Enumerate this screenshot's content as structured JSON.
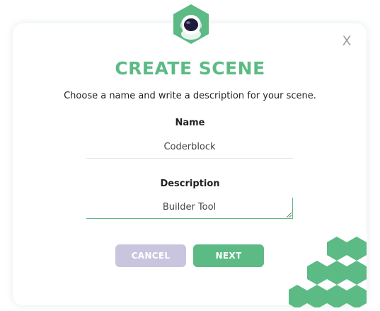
{
  "dialog": {
    "close_label": "X",
    "title": "CREATE SCENE",
    "subtitle": "Choose a name and write a description for your scene.",
    "name_label": "Name",
    "name_value": "Coderblock",
    "description_label": "Description",
    "description_value": "Builder Tool",
    "cancel_label": "CANCEL",
    "next_label": "NEXT"
  },
  "colors": {
    "accent": "#5cba85",
    "cancel": "#c9c5df",
    "text": "#222222"
  },
  "icons": {
    "logo": "astronaut-helmet-hexagon-icon",
    "decoration": "green-hexagon-cluster"
  }
}
